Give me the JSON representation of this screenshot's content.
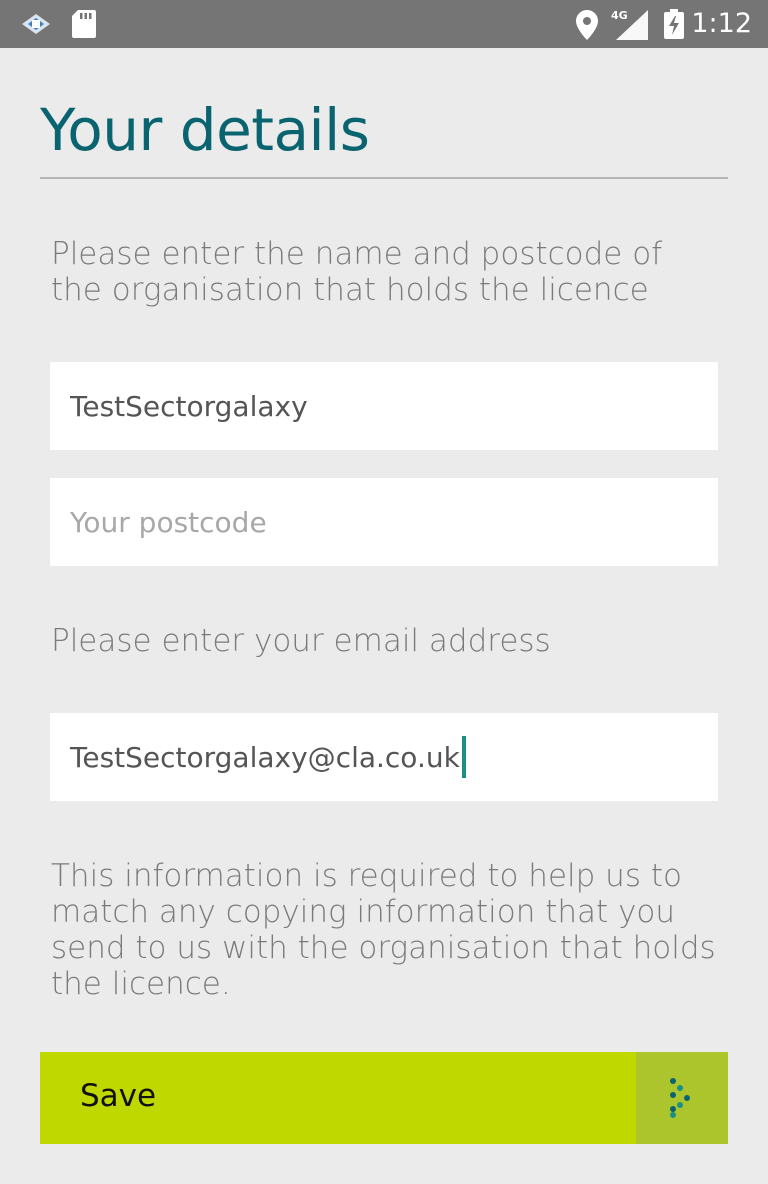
{
  "status_bar": {
    "time": "1:12",
    "network": "4G",
    "icons": [
      "app-notification-icon",
      "sd-card-icon",
      "location-icon",
      "cell-signal-icon",
      "battery-charging-icon"
    ]
  },
  "header": {
    "title": "Your details"
  },
  "organisation_section": {
    "instruction": "Please enter the name and postcode of the organisation that holds the licence",
    "name_value": "TestSectorgalaxy",
    "postcode_value": "",
    "postcode_placeholder": "Your postcode"
  },
  "email_section": {
    "instruction": "Please enter your email address",
    "email_value": "TestSectorgalaxy@cla.co.uk"
  },
  "info_text": "This information is required to help us to match any copying information that you send to us with the organisation that holds the licence.",
  "save_button": {
    "label": "Save",
    "icon": "arrow-dots-icon"
  },
  "colors": {
    "title": "#0a6470",
    "accent_button": "#bfd800",
    "accent_button_dark": "#adc52c",
    "caret": "#1a8f86",
    "status_bar": "#757575",
    "background": "#ebebeb"
  }
}
